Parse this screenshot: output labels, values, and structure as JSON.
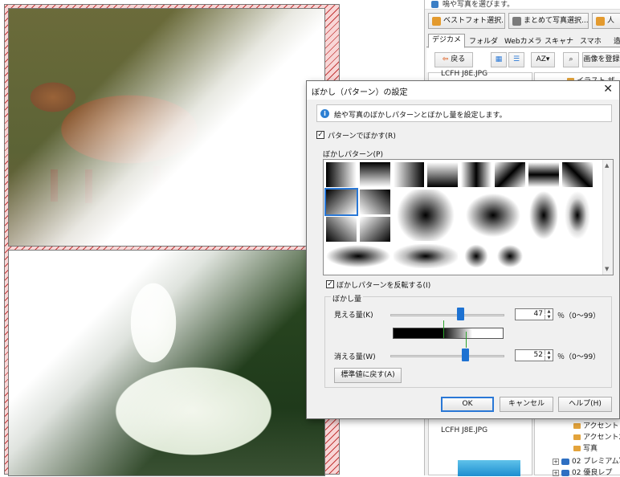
{
  "right_panel": {
    "title": "嗚や写真を選びます。",
    "buttons": [
      {
        "label": "ベストフォト選択...",
        "icon": "person-icon"
      },
      {
        "label": "まとめて写真選択...",
        "icon": "photos-icon"
      },
      {
        "label": "人",
        "icon": "person-icon"
      }
    ],
    "tabs": [
      "デジカメ",
      "フォルダ",
      "Webカメラ",
      "スキャナ",
      "スマホ",
      "造"
    ],
    "active_tab": 0,
    "toolbar": {
      "back_label": "戻る",
      "sort_label": "AZ",
      "search_right_label": "画像を登録"
    },
    "files": [
      "LCFH J8E.JPG",
      "LCFH J8E.JPG"
    ],
    "tree": [
      {
        "label": "イラスト ザ",
        "type": "folder"
      },
      {
        "label": "アクセント",
        "type": "folder"
      },
      {
        "label": "アクセント2",
        "type": "folder"
      },
      {
        "label": "写真",
        "type": "folder"
      },
      {
        "label": "02 プレミアム写",
        "type": "disk"
      },
      {
        "label": "02 優良レプ",
        "type": "disk"
      }
    ]
  },
  "dialog": {
    "title": "ぼかし（パターン）の設定",
    "close_label": "✕",
    "info_text": "絵や写真のぼかしパターンとぼかし量を設定します。",
    "use_pattern_label": "パターンでぼかす(R)",
    "use_pattern_checked": true,
    "pattern_group_label": "ぼかしパターン(P)",
    "invert_label": "ぼかしパターンを反転する(I)",
    "invert_checked": true,
    "amount_group_label": "ぼかし量",
    "visible_amount": {
      "label": "見える量(K)",
      "value": "47",
      "range_label": "％（0～99）",
      "fraction": 0.47
    },
    "fade_amount": {
      "label": "消える量(W)",
      "value": "52",
      "range_label": "％（0～99）",
      "fraction": 0.52
    },
    "reset_label": "標準値に戻す(A)",
    "ok_label": "OK",
    "cancel_label": "キャンセル",
    "help_label": "ヘルプ(H)"
  },
  "colors": {
    "accent": "#2a78d6",
    "slider_thumb": "#1e72d2"
  }
}
